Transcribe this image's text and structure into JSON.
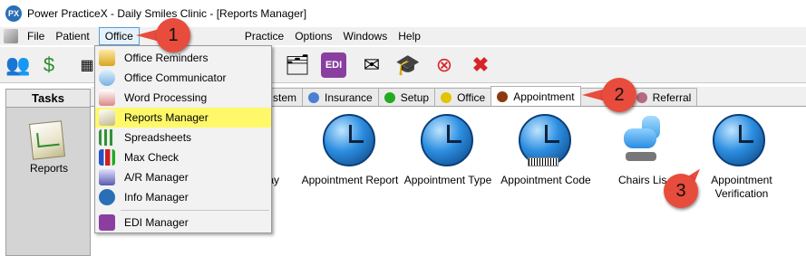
{
  "window": {
    "app_icon_text": "PX",
    "title": "Power PracticeX - Daily Smiles Clinic - [Reports Manager]"
  },
  "menubar": {
    "items": [
      "File",
      "Patient",
      "Office",
      "Practice",
      "Options",
      "Windows",
      "Help"
    ],
    "active": "Office"
  },
  "office_menu": {
    "items": [
      {
        "label": "Office Reminders",
        "icon": "reminders-icon"
      },
      {
        "label": "Office Communicator",
        "icon": "communicator-icon"
      },
      {
        "label": "Word Processing",
        "icon": "word-processing-icon"
      },
      {
        "label": "Reports Manager",
        "icon": "reports-manager-icon",
        "highlighted": true
      },
      {
        "label": "Spreadsheets",
        "icon": "spreadsheet-icon"
      },
      {
        "label": "Max Check",
        "icon": "bar-chart-icon"
      },
      {
        "label": "A/R Manager",
        "icon": "ar-manager-icon"
      },
      {
        "label": "Info Manager",
        "icon": "info-icon"
      },
      {
        "label": "EDI Manager",
        "icon": "edi-icon"
      }
    ],
    "highlight_color": "#fff96a"
  },
  "toolbar": {
    "buttons": [
      "patients-icon",
      "money-icon",
      "edi-icon",
      "mail-icon",
      "graduation-cap-icon",
      "cancel-circle-icon",
      "close-x-icon"
    ]
  },
  "tasks": {
    "header": "Tasks",
    "reports_label": "Reports"
  },
  "tabs": [
    {
      "label": "System",
      "partial": "stem",
      "color": "#4a7fd4"
    },
    {
      "label": "Insurance",
      "color": "#4a7fd4"
    },
    {
      "label": "Setup",
      "color": "#22aa22"
    },
    {
      "label": "Office",
      "color": "#e2c400"
    },
    {
      "label": "Appointment",
      "color": "#8a3a10",
      "active": true
    },
    {
      "label": "Clinical",
      "partial": "ical",
      "color": "#9b8f8f"
    },
    {
      "label": "Referral",
      "color": "#b56a7f"
    }
  ],
  "content_icons": {
    "day_label_partial": "t Day",
    "items": [
      {
        "label": "Appointment Report"
      },
      {
        "label": "Appointment Type"
      },
      {
        "label": "Appointment Code"
      },
      {
        "label": "Chairs List",
        "partial": "Chairs Lis"
      },
      {
        "label": "Appointment Verification"
      }
    ]
  },
  "callouts": [
    "1",
    "2",
    "3"
  ],
  "accent_colors": {
    "callout": "#e84c3d",
    "menu_active_border": "#5b9bd5"
  }
}
